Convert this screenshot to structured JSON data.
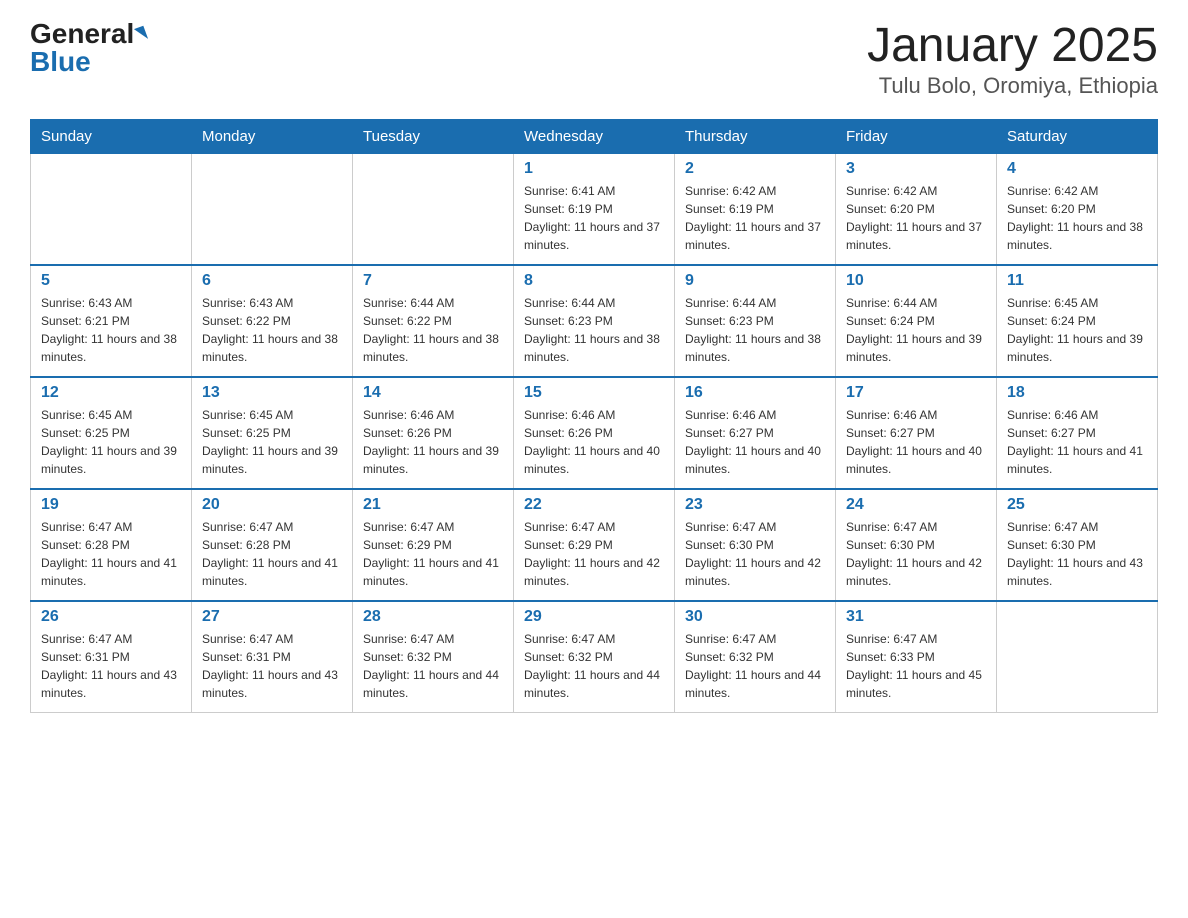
{
  "logo": {
    "general": "General",
    "blue": "Blue"
  },
  "title": "January 2025",
  "subtitle": "Tulu Bolo, Oromiya, Ethiopia",
  "days_of_week": [
    "Sunday",
    "Monday",
    "Tuesday",
    "Wednesday",
    "Thursday",
    "Friday",
    "Saturday"
  ],
  "weeks": [
    [
      {
        "day": "",
        "info": ""
      },
      {
        "day": "",
        "info": ""
      },
      {
        "day": "",
        "info": ""
      },
      {
        "day": "1",
        "info": "Sunrise: 6:41 AM\nSunset: 6:19 PM\nDaylight: 11 hours and 37 minutes."
      },
      {
        "day": "2",
        "info": "Sunrise: 6:42 AM\nSunset: 6:19 PM\nDaylight: 11 hours and 37 minutes."
      },
      {
        "day": "3",
        "info": "Sunrise: 6:42 AM\nSunset: 6:20 PM\nDaylight: 11 hours and 37 minutes."
      },
      {
        "day": "4",
        "info": "Sunrise: 6:42 AM\nSunset: 6:20 PM\nDaylight: 11 hours and 38 minutes."
      }
    ],
    [
      {
        "day": "5",
        "info": "Sunrise: 6:43 AM\nSunset: 6:21 PM\nDaylight: 11 hours and 38 minutes."
      },
      {
        "day": "6",
        "info": "Sunrise: 6:43 AM\nSunset: 6:22 PM\nDaylight: 11 hours and 38 minutes."
      },
      {
        "day": "7",
        "info": "Sunrise: 6:44 AM\nSunset: 6:22 PM\nDaylight: 11 hours and 38 minutes."
      },
      {
        "day": "8",
        "info": "Sunrise: 6:44 AM\nSunset: 6:23 PM\nDaylight: 11 hours and 38 minutes."
      },
      {
        "day": "9",
        "info": "Sunrise: 6:44 AM\nSunset: 6:23 PM\nDaylight: 11 hours and 38 minutes."
      },
      {
        "day": "10",
        "info": "Sunrise: 6:44 AM\nSunset: 6:24 PM\nDaylight: 11 hours and 39 minutes."
      },
      {
        "day": "11",
        "info": "Sunrise: 6:45 AM\nSunset: 6:24 PM\nDaylight: 11 hours and 39 minutes."
      }
    ],
    [
      {
        "day": "12",
        "info": "Sunrise: 6:45 AM\nSunset: 6:25 PM\nDaylight: 11 hours and 39 minutes."
      },
      {
        "day": "13",
        "info": "Sunrise: 6:45 AM\nSunset: 6:25 PM\nDaylight: 11 hours and 39 minutes."
      },
      {
        "day": "14",
        "info": "Sunrise: 6:46 AM\nSunset: 6:26 PM\nDaylight: 11 hours and 39 minutes."
      },
      {
        "day": "15",
        "info": "Sunrise: 6:46 AM\nSunset: 6:26 PM\nDaylight: 11 hours and 40 minutes."
      },
      {
        "day": "16",
        "info": "Sunrise: 6:46 AM\nSunset: 6:27 PM\nDaylight: 11 hours and 40 minutes."
      },
      {
        "day": "17",
        "info": "Sunrise: 6:46 AM\nSunset: 6:27 PM\nDaylight: 11 hours and 40 minutes."
      },
      {
        "day": "18",
        "info": "Sunrise: 6:46 AM\nSunset: 6:27 PM\nDaylight: 11 hours and 41 minutes."
      }
    ],
    [
      {
        "day": "19",
        "info": "Sunrise: 6:47 AM\nSunset: 6:28 PM\nDaylight: 11 hours and 41 minutes."
      },
      {
        "day": "20",
        "info": "Sunrise: 6:47 AM\nSunset: 6:28 PM\nDaylight: 11 hours and 41 minutes."
      },
      {
        "day": "21",
        "info": "Sunrise: 6:47 AM\nSunset: 6:29 PM\nDaylight: 11 hours and 41 minutes."
      },
      {
        "day": "22",
        "info": "Sunrise: 6:47 AM\nSunset: 6:29 PM\nDaylight: 11 hours and 42 minutes."
      },
      {
        "day": "23",
        "info": "Sunrise: 6:47 AM\nSunset: 6:30 PM\nDaylight: 11 hours and 42 minutes."
      },
      {
        "day": "24",
        "info": "Sunrise: 6:47 AM\nSunset: 6:30 PM\nDaylight: 11 hours and 42 minutes."
      },
      {
        "day": "25",
        "info": "Sunrise: 6:47 AM\nSunset: 6:30 PM\nDaylight: 11 hours and 43 minutes."
      }
    ],
    [
      {
        "day": "26",
        "info": "Sunrise: 6:47 AM\nSunset: 6:31 PM\nDaylight: 11 hours and 43 minutes."
      },
      {
        "day": "27",
        "info": "Sunrise: 6:47 AM\nSunset: 6:31 PM\nDaylight: 11 hours and 43 minutes."
      },
      {
        "day": "28",
        "info": "Sunrise: 6:47 AM\nSunset: 6:32 PM\nDaylight: 11 hours and 44 minutes."
      },
      {
        "day": "29",
        "info": "Sunrise: 6:47 AM\nSunset: 6:32 PM\nDaylight: 11 hours and 44 minutes."
      },
      {
        "day": "30",
        "info": "Sunrise: 6:47 AM\nSunset: 6:32 PM\nDaylight: 11 hours and 44 minutes."
      },
      {
        "day": "31",
        "info": "Sunrise: 6:47 AM\nSunset: 6:33 PM\nDaylight: 11 hours and 45 minutes."
      },
      {
        "day": "",
        "info": ""
      }
    ]
  ]
}
